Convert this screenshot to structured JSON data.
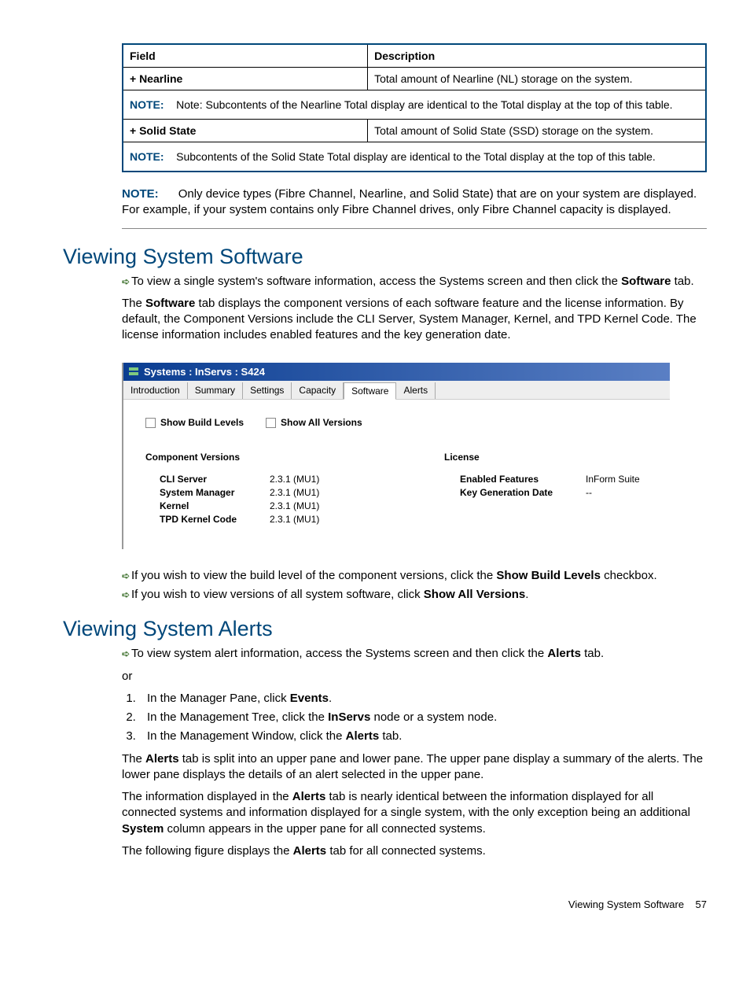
{
  "table": {
    "header_field": "Field",
    "header_desc": "Description",
    "row1_field": "+ Nearline",
    "row1_desc": "Total amount of Nearline (NL) storage on the system.",
    "note1_label": "NOTE:",
    "note1_text": "Note: Subcontents of the Nearline Total display are identical to the Total display at the top of this table.",
    "row2_field": "+ Solid State",
    "row2_desc": "Total amount of Solid State (SSD) storage on the system.",
    "note2_label": "NOTE:",
    "note2_text": "Subcontents of the Solid State Total display are identical to the Total display at the top of this table."
  },
  "top_note": {
    "label": "NOTE:",
    "text": "Only device types (Fibre Channel, Nearline, and Solid State) that are on your system are displayed. For example, if your system contains only Fibre Channel drives, only Fibre Channel capacity is displayed."
  },
  "sec_software": {
    "heading": "Viewing System Software",
    "p1a": "To view a single system's software information, access the Systems screen and then click the ",
    "p1b": "Software",
    "p1c": " tab.",
    "p2a": "The ",
    "p2b": "Software",
    "p2c": " tab displays the component versions of each software feature and the license information. By default, the Component Versions include the CLI Server, System Manager, Kernel, and TPD Kernel Code. The license information includes enabled features and the key generation date."
  },
  "screenshot": {
    "titlebar": "Systems : InServs : S424",
    "tabs": [
      "Introduction",
      "Summary",
      "Settings",
      "Capacity",
      "Software",
      "Alerts"
    ],
    "active_tab_index": 4,
    "cb1": "Show Build Levels",
    "cb2": "Show All Versions",
    "col1_head": "Component Versions",
    "col2_head": "License",
    "components": [
      {
        "k": "CLI Server",
        "v": "2.3.1 (MU1)"
      },
      {
        "k": "System Manager",
        "v": "2.3.1 (MU1)"
      },
      {
        "k": "Kernel",
        "v": "2.3.1 (MU1)"
      },
      {
        "k": "TPD Kernel Code",
        "v": "2.3.1 (MU1)"
      }
    ],
    "license": [
      {
        "k": "Enabled Features",
        "v": "InForm Suite"
      },
      {
        "k": "Key Generation Date",
        "v": "--"
      }
    ]
  },
  "after_shot": {
    "l1a": "If you wish to view the build level of the component versions, click the ",
    "l1b": "Show Build Levels",
    "l1c": " checkbox.",
    "l2a": "If you wish to view versions of all system software, click ",
    "l2b": "Show All Versions",
    "l2c": "."
  },
  "sec_alerts": {
    "heading": "Viewing System Alerts",
    "p1a": "To view system alert information, access the Systems screen and then click the ",
    "p1b": "Alerts",
    "p1c": " tab.",
    "or": "or",
    "li1a": "In the Manager Pane, click ",
    "li1b": "Events",
    "li1c": ".",
    "li2a": "In the Management Tree, click the ",
    "li2b": "InServs",
    "li2c": " node or a system node.",
    "li3a": "In the Management Window, click the ",
    "li3b": "Alerts",
    "li3c": " tab.",
    "p2a": "The ",
    "p2b": "Alerts",
    "p2c": " tab is split into an upper pane and lower pane. The upper pane display a summary of the alerts. The lower pane displays the details of an alert selected in the upper pane.",
    "p3a": "The information displayed in the ",
    "p3b": "Alerts",
    "p3c": " tab is nearly identical between the information displayed for all connected systems and information displayed for a single system, with the only exception being an additional ",
    "p3d": "System",
    "p3e": " column appears in the upper pane for all connected systems.",
    "p4a": "The following figure displays the ",
    "p4b": "Alerts",
    "p4c": " tab for all connected systems."
  },
  "footer": {
    "text": "Viewing System Software",
    "page": "57"
  }
}
